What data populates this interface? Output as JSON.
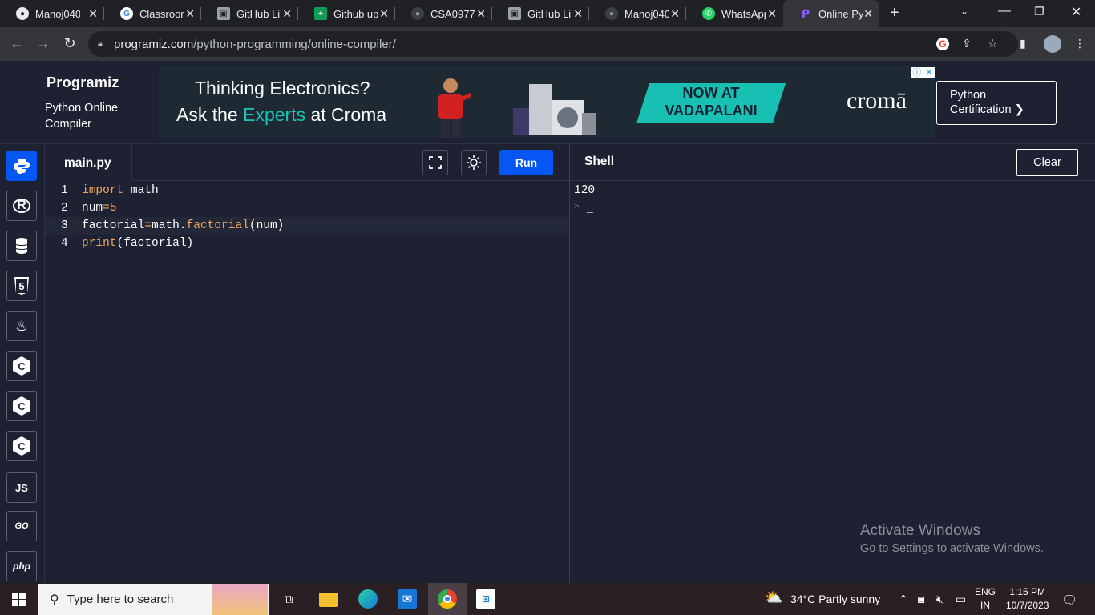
{
  "browser": {
    "tabs": [
      {
        "title": "Manoj040",
        "icon": "github-icon"
      },
      {
        "title": "Classroom",
        "icon": "google-icon"
      },
      {
        "title": "GitHub Lir",
        "icon": "image-icon"
      },
      {
        "title": "Github up",
        "icon": "sheets-icon"
      },
      {
        "title": "CSA0977-",
        "icon": "github-icon"
      },
      {
        "title": "GitHub Lir",
        "icon": "image-icon"
      },
      {
        "title": "Manoj040",
        "icon": "github-icon"
      },
      {
        "title": "WhatsApp",
        "icon": "whatsapp-icon"
      },
      {
        "title": "Online Py",
        "icon": "programiz-icon"
      }
    ],
    "url_domain": "programiz.com",
    "url_path": "/python-programming/online-compiler/"
  },
  "header": {
    "logo": "Programiz",
    "subtitle": "Python Online Compiler",
    "cert_button": "Python Certification ❯"
  },
  "ad": {
    "line1": "Thinking Electronics?",
    "line2_a": "Ask the ",
    "line2_b": "Experts",
    "line2_c": " at Croma",
    "badge_l1": "NOW AT",
    "badge_l2": "VADAPALANI",
    "brand": "cromā"
  },
  "sidebar": {
    "items": [
      {
        "name": "python",
        "label": ""
      },
      {
        "name": "r",
        "label": "R"
      },
      {
        "name": "sql",
        "label": ""
      },
      {
        "name": "html",
        "label": "5"
      },
      {
        "name": "java",
        "label": ""
      },
      {
        "name": "c",
        "label": "C"
      },
      {
        "name": "cpp",
        "label": "C"
      },
      {
        "name": "csharp",
        "label": "C"
      },
      {
        "name": "js",
        "label": "JS"
      },
      {
        "name": "go",
        "label": "GO"
      },
      {
        "name": "php",
        "label": "php"
      }
    ]
  },
  "editor": {
    "file_name": "main.py",
    "run_label": "Run",
    "lines": [
      {
        "n": "1"
      },
      {
        "n": "2"
      },
      {
        "n": "3"
      },
      {
        "n": "4"
      }
    ],
    "code": {
      "l1_kw": "import",
      "l1_rest": " math",
      "l2_a": "num",
      "l2_op": "=",
      "l2_num": "5",
      "l3_a": "factorial",
      "l3_op": "=",
      "l3_b": "math.",
      "l3_fn": "factorial",
      "l3_c": "(num)",
      "l4_fn": "print",
      "l4_rest": "(factorial)"
    }
  },
  "shell": {
    "title": "Shell",
    "clear_label": "Clear",
    "output": "120",
    "prompt": ">",
    "cursor": "_"
  },
  "watermark": {
    "line1": "Activate Windows",
    "line2": "Go to Settings to activate Windows."
  },
  "taskbar": {
    "search_placeholder": "Type here to search",
    "weather": "34°C  Partly sunny",
    "lang1": "ENG",
    "lang2": "IN",
    "time": "1:15 PM",
    "date": "10/7/2023"
  }
}
